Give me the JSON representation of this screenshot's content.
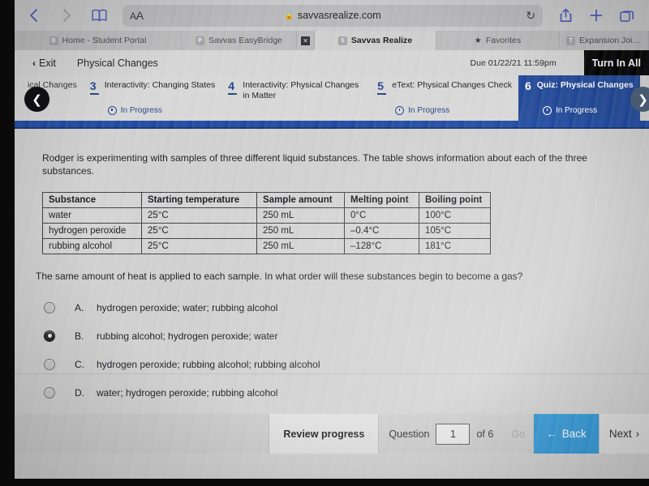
{
  "browser": {
    "url": "savvasrealize.com",
    "text_size_label": "AA",
    "icons": {
      "back": "back-chevron-icon",
      "forward": "forward-chevron-icon",
      "bookmarks": "book-icon",
      "lock": "lock-icon",
      "reload": "reload-icon",
      "share": "share-icon",
      "new_tab": "plus-icon",
      "tab_overview": "tabs-icon"
    },
    "tabs": [
      {
        "favicon": "D",
        "label": "Home - Student Portal",
        "active": false
      },
      {
        "favicon": "P",
        "label": "Savvas EasyBridge",
        "active": false
      },
      {
        "favicon": "S",
        "label": "Savvas Realize",
        "active": true
      },
      {
        "favicon": "star",
        "label": "Favorites",
        "active": false
      },
      {
        "favicon": "T",
        "label": "Expansion Joint in Con...",
        "active": false
      }
    ]
  },
  "app_header": {
    "exit_label": "Exit",
    "assignment_title": "Physical Changes",
    "due_label": "Due 01/22/21 11:59pm",
    "turn_in_label": "Turn In All"
  },
  "step_nav": {
    "prev_arrow": "prev-arrow-icon",
    "next_arrow": "next-arrow-icon",
    "steps": [
      {
        "number": "",
        "title": "ical Changes",
        "status": "",
        "current": false
      },
      {
        "number": "3",
        "title": "Interactivity: Changing States",
        "status": "In Progress",
        "current": false
      },
      {
        "number": "4",
        "title": "Interactivity: Physical Changes in Matter",
        "status": "",
        "current": false
      },
      {
        "number": "5",
        "title": "eText: Physical Changes Check",
        "status": "In Progress",
        "current": false
      },
      {
        "number": "6",
        "title": "Quiz: Physical Changes",
        "status": "In Progress",
        "current": true
      }
    ]
  },
  "question": {
    "stem": "Rodger is experimenting with samples of three different liquid substances. The table shows information about each of the three substances.",
    "prompt": "The same amount of heat is applied to each sample. In what order will these substances begin to become a gas?",
    "table": {
      "headers": [
        "Substance",
        "Starting temperature",
        "Sample amount",
        "Melting point",
        "Boiling point"
      ],
      "rows": [
        [
          "water",
          "25°C",
          "250 mL",
          "0°C",
          "100°C"
        ],
        [
          "hydrogen peroxide",
          "25°C",
          "250 mL",
          "–0.4°C",
          "105°C"
        ],
        [
          "rubbing alcohol",
          "25°C",
          "250 mL",
          "–128°C",
          "181°C"
        ]
      ]
    },
    "choices": [
      {
        "letter": "A.",
        "text": "hydrogen peroxide; water; rubbing alcohol",
        "selected": false
      },
      {
        "letter": "B.",
        "text": "rubbing alcohol; hydrogen peroxide; water",
        "selected": true
      },
      {
        "letter": "C.",
        "text": "hydrogen peroxide; rubbing alcohol; rubbing alcohol",
        "selected": false
      },
      {
        "letter": "D.",
        "text": "water; hydrogen peroxide; rubbing alcohol",
        "selected": false
      }
    ]
  },
  "bottom_bar": {
    "review_progress_label": "Review progress",
    "question_label": "Question",
    "question_number": "1",
    "of_label": "of 6",
    "go_label": "Go",
    "back_label": "Back",
    "next_label": "Next",
    "back_arrow": "left-arrow-icon",
    "next_arrow": "right-arrow-icon"
  },
  "colors": {
    "accent_blue": "#1f4696",
    "back_button_blue": "#1b8fd6",
    "turn_in_black": "#000000",
    "rule_blue": "#1b47a0"
  }
}
